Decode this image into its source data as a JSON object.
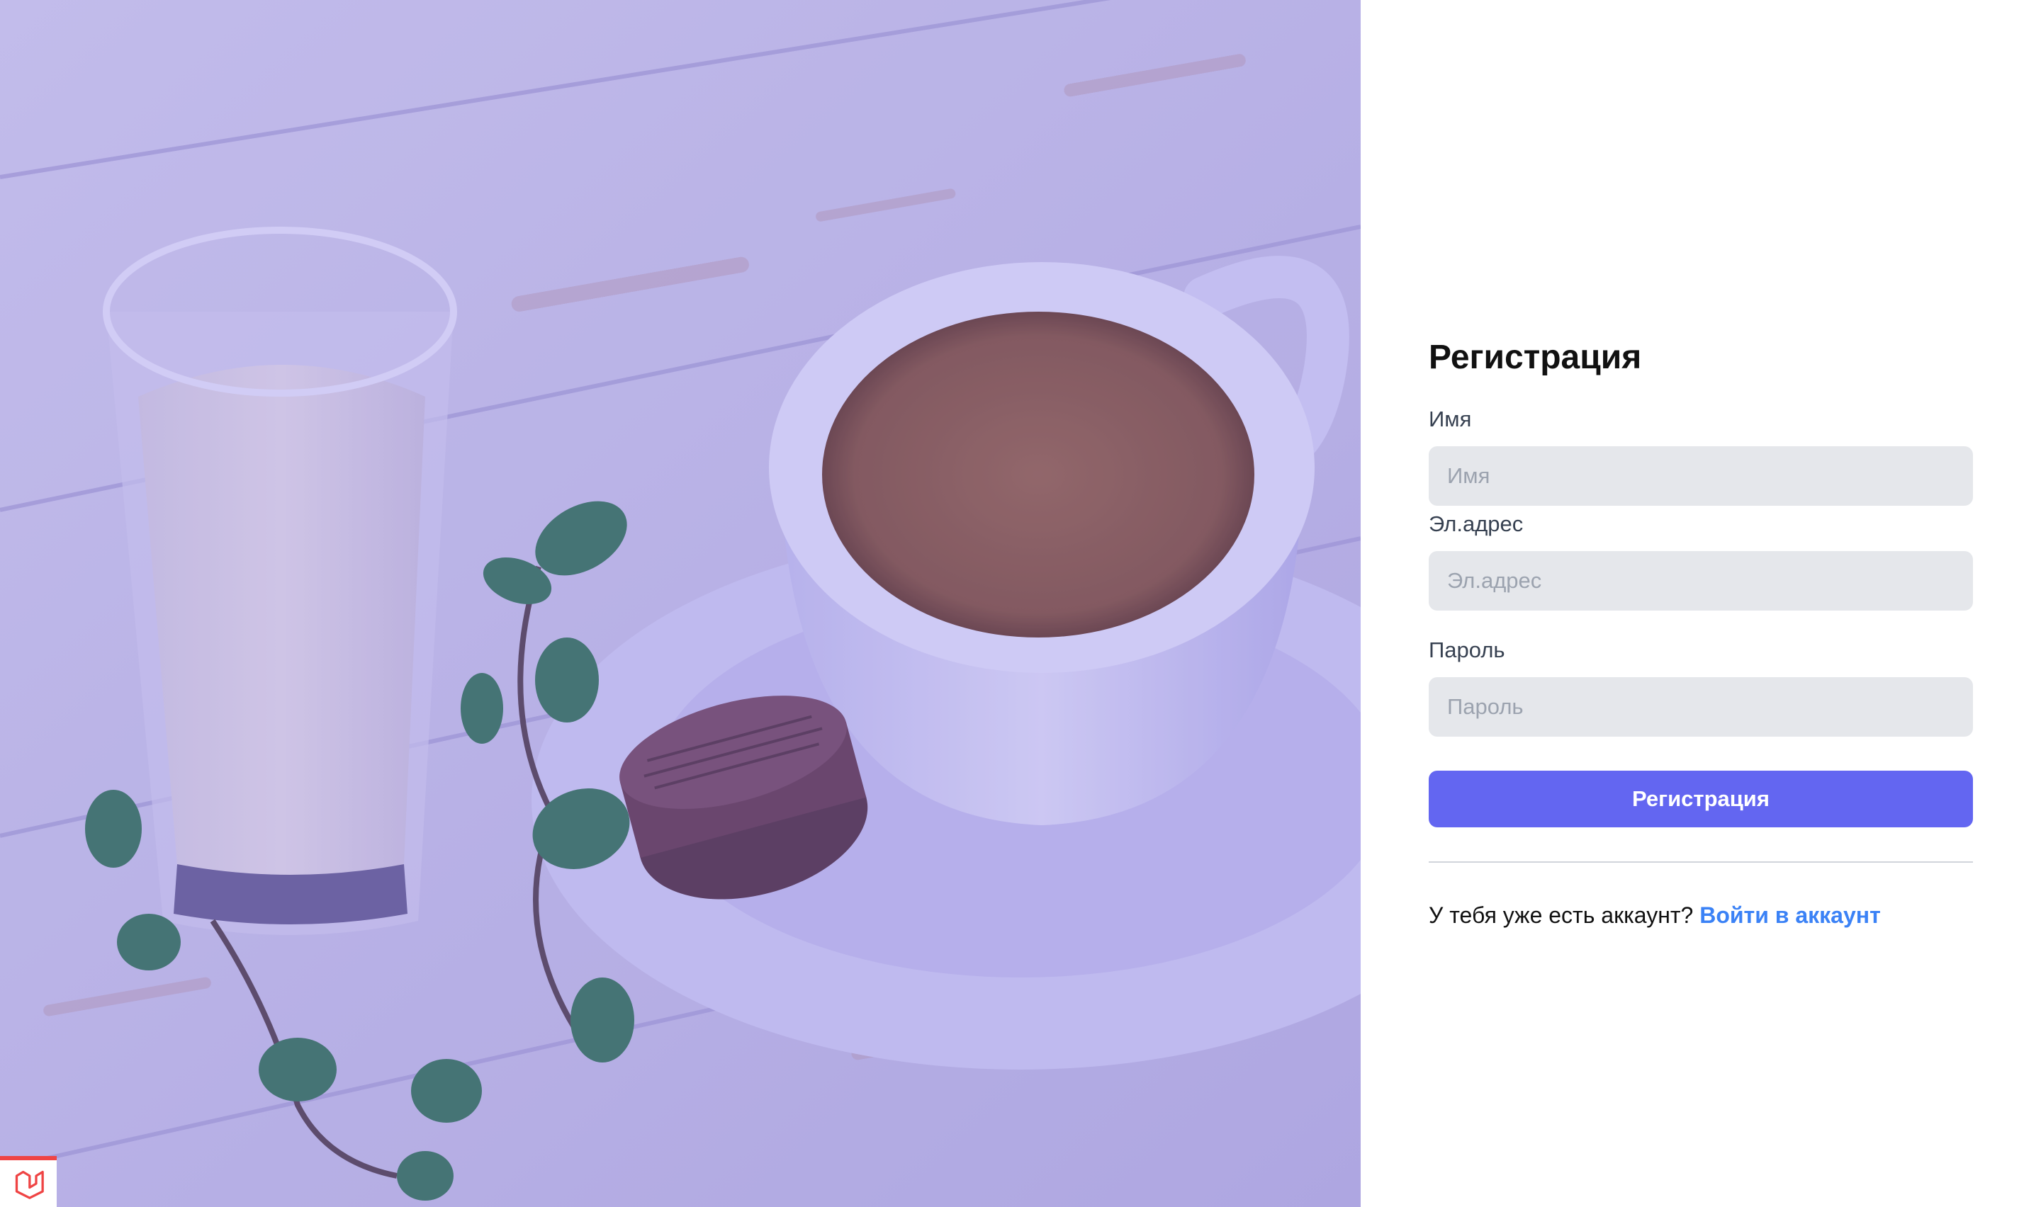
{
  "hero": {
    "image_description_icon": "coffee-milk-photo",
    "tint_color": "#635bdc",
    "dev_badge_icon": "laravel-logo-icon",
    "dev_badge_color": "#ef4444"
  },
  "form": {
    "title": "Регистрация",
    "name": {
      "label": "Имя",
      "placeholder": "Имя",
      "value": ""
    },
    "email": {
      "label": "Эл.адрес",
      "placeholder": "Эл.адрес",
      "value": ""
    },
    "password": {
      "label": "Пароль",
      "placeholder": "Пароль",
      "value": ""
    },
    "submit_label": "Регистрация",
    "footer_prompt": "У тебя уже есть аккаунт?",
    "footer_link": "Войти в аккаунт"
  },
  "colors": {
    "accent": "#6366f1",
    "link": "#3b82f6",
    "input_bg": "#e5e7eb",
    "placeholder": "#9ca3af"
  }
}
